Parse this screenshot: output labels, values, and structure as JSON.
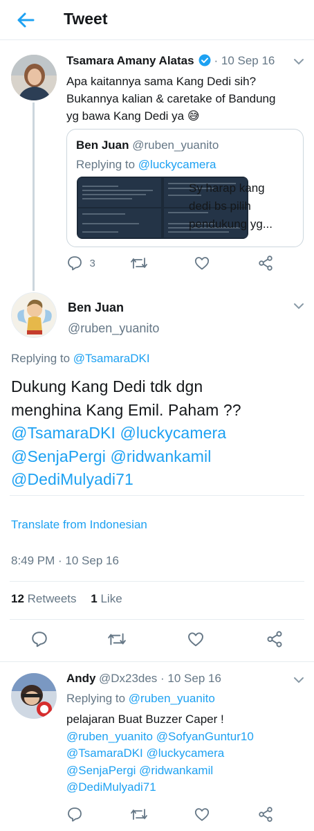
{
  "header": {
    "title": "Tweet"
  },
  "thread_parent": {
    "name": "Tsamara Amany Alatas",
    "date": "10 Sep 16",
    "text_lines": [
      "Apa kaitannya sama Kang Dedi sih?",
      "Bukannya kalian & caretake of Bandung",
      "yg bawa Kang Dedi ya"
    ],
    "emoji": "😅",
    "quote": {
      "name": "Ben Juan",
      "handle": "@ruben_yuanito",
      "replying_prefix": "Replying to ",
      "replying_to": "@luckycamera",
      "text_lines": [
        "Sy harap kang",
        "dedi bs pilih",
        "pendukung yg..."
      ]
    },
    "reply_count": "3"
  },
  "main_tweet": {
    "name": "Ben Juan",
    "handle": "@ruben_yuanito",
    "replying_prefix": "Replying to ",
    "replying_to": "@TsamaraDKI",
    "text_line1": "Dukung Kang Dedi tdk dgn",
    "text_line2": "menghina Kang Emil. Paham ??",
    "mentions_line1": "@TsamaraDKI @luckycamera",
    "mentions_line2": "@SenjaPergi @ridwankamil",
    "mentions_line3": "@DediMulyadi71",
    "translate": "Translate from Indonesian",
    "timestamp": "8:49 PM · 10 Sep 16",
    "retweets_count": "12",
    "retweets_label": "Retweets",
    "likes_count": "1",
    "likes_label": "Like"
  },
  "reply": {
    "name": "Andy",
    "handle": "@Dx23des",
    "date": "10 Sep 16",
    "replying_prefix": "Replying to ",
    "replying_to": "@ruben_yuanito",
    "text": "pelajaran Buat Buzzer Caper !",
    "mentions_line1": "@ruben_yuanito @SofyanGuntur10",
    "mentions_line2": "@TsamaraDKI @luckycamera",
    "mentions_line3": "@SenjaPergi @ridwankamil",
    "mentions_line4": "@DediMulyadi71"
  },
  "colors": {
    "accent": "#1da1f2",
    "secondary_text": "#657786",
    "divider": "#e6ecf0",
    "verified": "#1da1f2"
  }
}
